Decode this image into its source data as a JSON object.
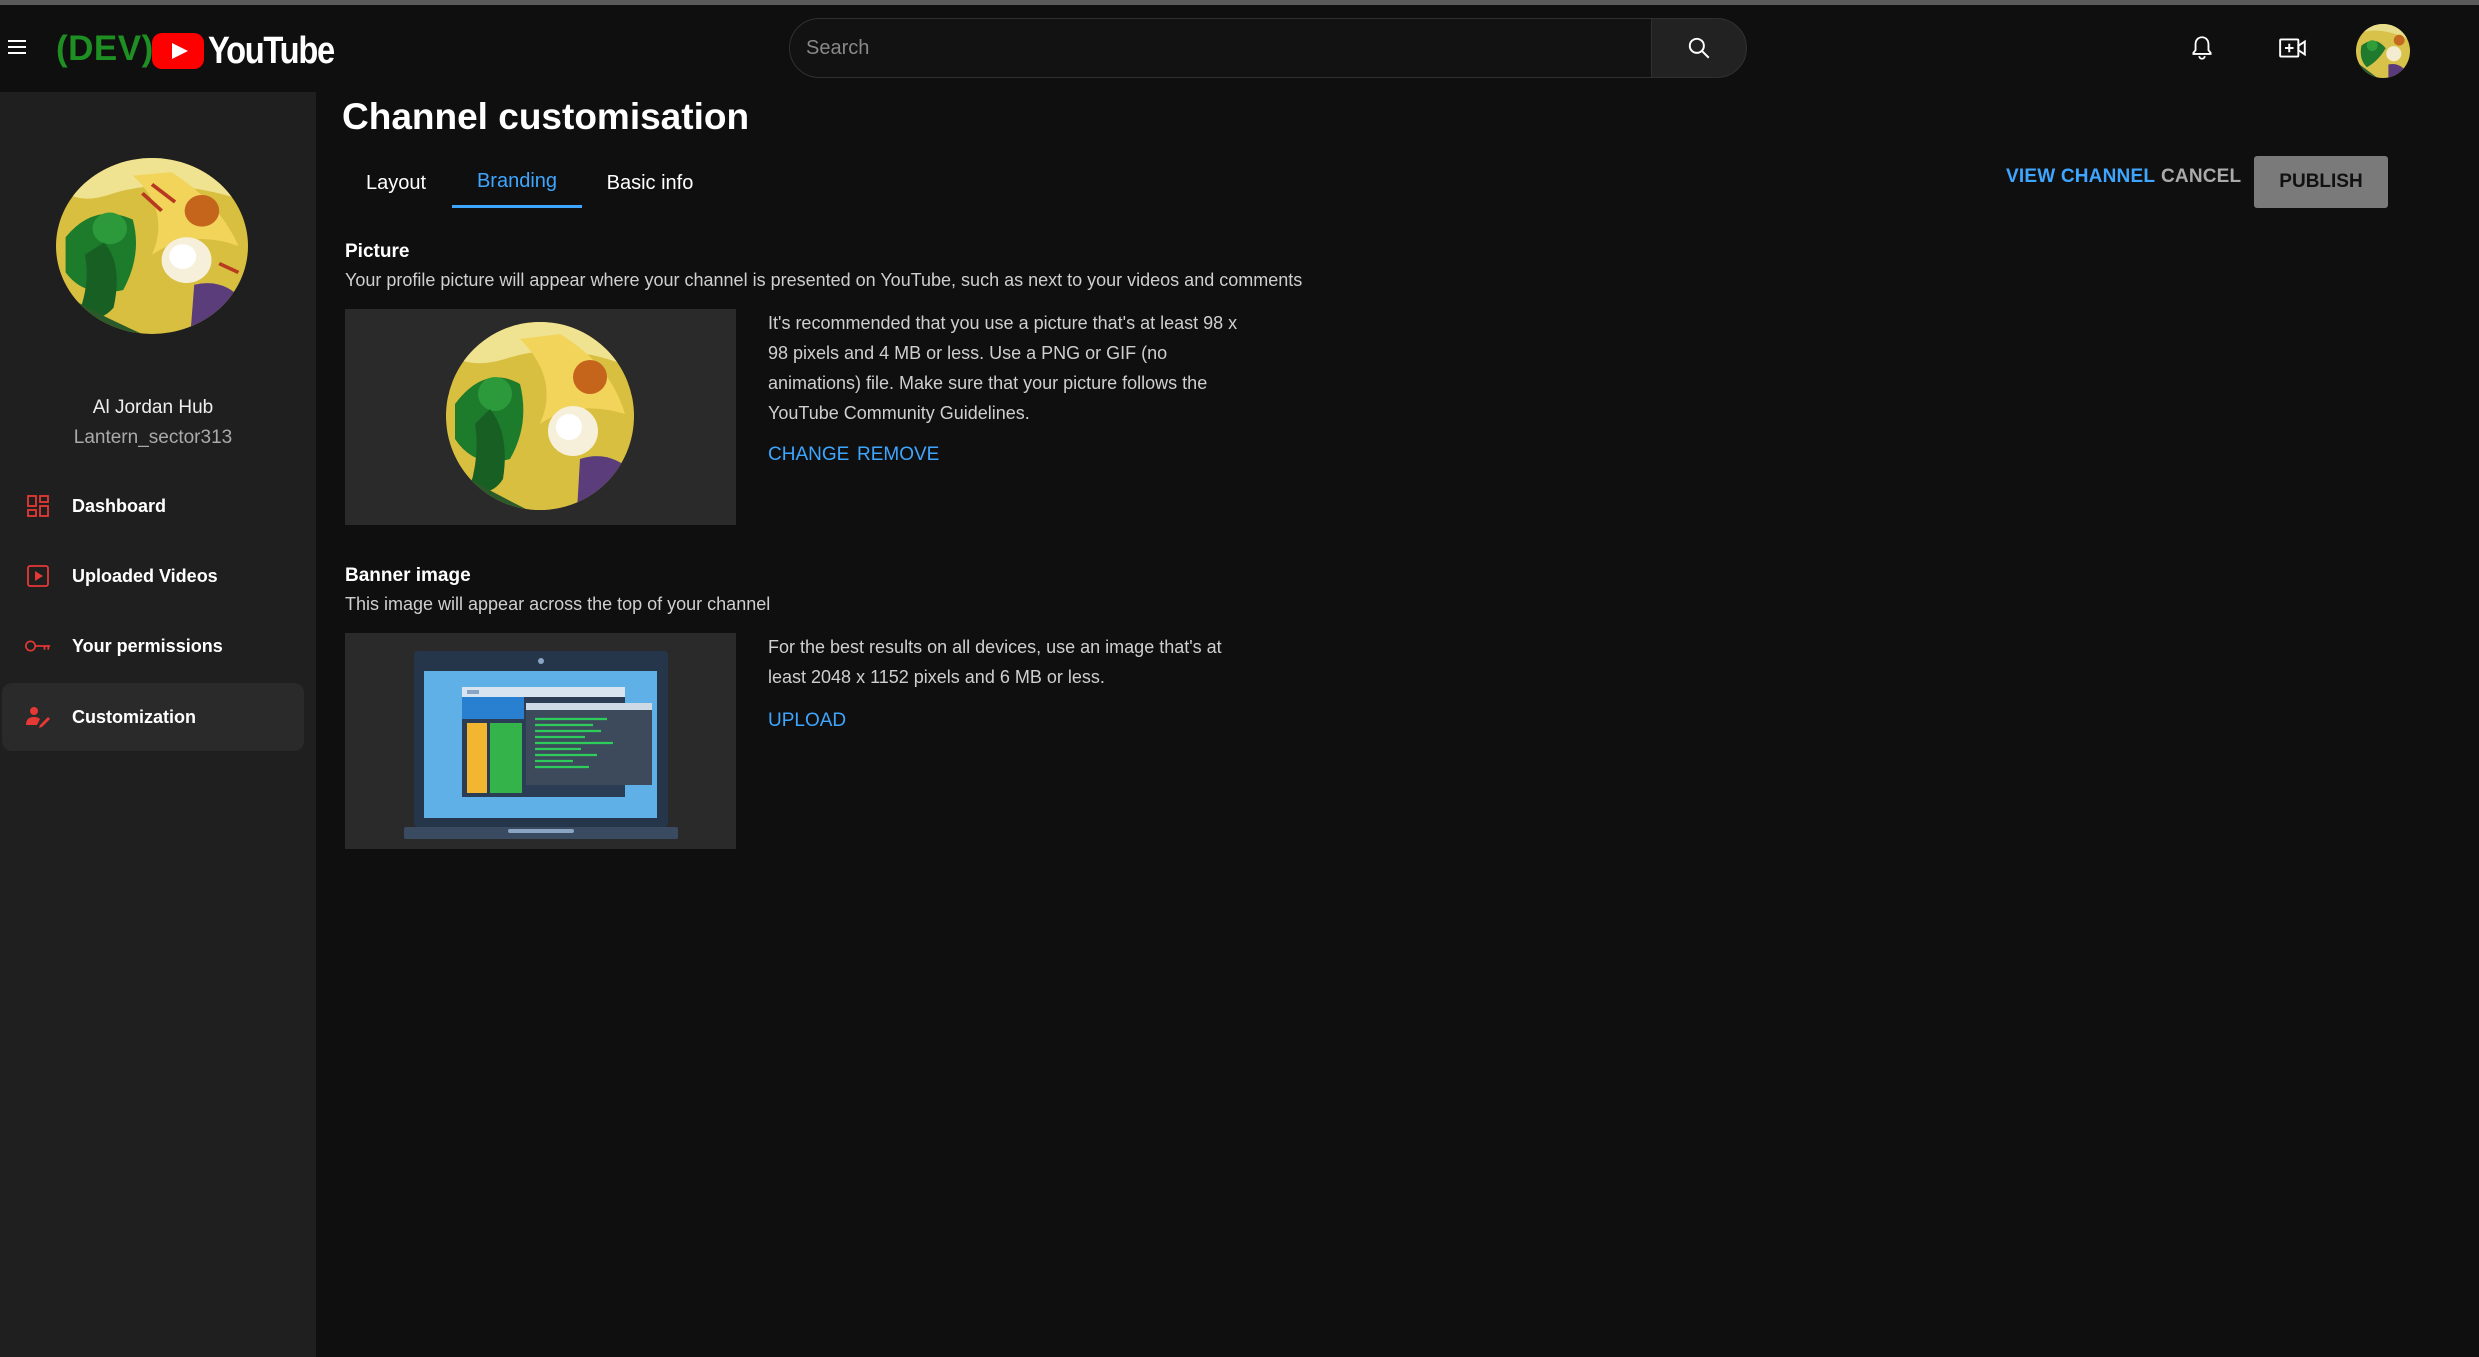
{
  "header": {
    "dev_tag": "(DEV)",
    "logo_text": "YouTube",
    "search_placeholder": "Search",
    "icons": [
      "menu-icon",
      "search-icon",
      "bell-icon",
      "create-video-icon",
      "avatar"
    ]
  },
  "sidebar": {
    "channel_name": "Al Jordan Hub",
    "channel_handle": "Lantern_sector313",
    "items": [
      {
        "label": "Dashboard",
        "icon": "dashboard-icon",
        "active": false
      },
      {
        "label": "Uploaded Videos",
        "icon": "video-icon",
        "active": false
      },
      {
        "label": "Your permissions",
        "icon": "key-icon",
        "active": false
      },
      {
        "label": "Customization",
        "icon": "customization-icon",
        "active": true
      }
    ]
  },
  "main": {
    "title": "Channel customisation",
    "tabs": [
      {
        "label": "Layout",
        "active": false
      },
      {
        "label": "Branding",
        "active": true
      },
      {
        "label": "Basic info",
        "active": false
      }
    ],
    "actions": {
      "view_channel": "VIEW CHANNEL",
      "cancel": "CANCEL",
      "publish": "PUBLISH"
    },
    "picture": {
      "title": "Picture",
      "description": "Your profile picture will appear where your channel is presented on YouTube, such as next to your videos and comments",
      "info": "It's recommended that you use a picture that's at least 98 x 98 pixels and 4 MB or less. Use a PNG or GIF (no animations) file. Make sure that your picture follows the YouTube Community Guidelines.",
      "change": "CHANGE",
      "remove": "REMOVE"
    },
    "banner": {
      "title": "Banner image",
      "description": "This image will appear across the top of your channel",
      "info": "For the best results on all devices, use an image that's at least 2048 x 1152 pixels and 6 MB or less.",
      "upload": "UPLOAD"
    }
  },
  "colors": {
    "background": "#0f0f0f",
    "sidebar": "#1f1f1f",
    "accent": "#3ea6ff",
    "dev_green": "#1e8f22",
    "brand_red": "#ff0000",
    "nav_icon_red": "#e53935"
  }
}
